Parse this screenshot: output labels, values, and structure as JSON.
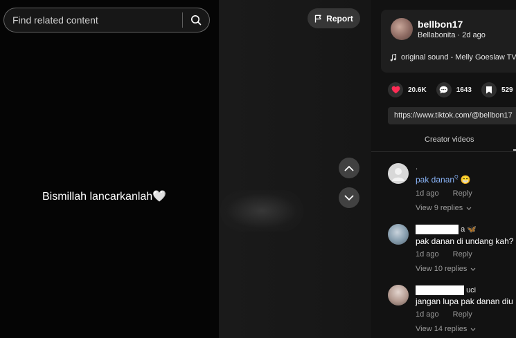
{
  "search": {
    "placeholder": "Find related content"
  },
  "report": {
    "label": "Report"
  },
  "video": {
    "caption": "Bismillah lancarkanlah🤍"
  },
  "author": {
    "username": "bellbon17",
    "nickname_date": "Bellabonita · 2d ago",
    "music": "original sound - Melly Goeslaw TV"
  },
  "stats": {
    "likes": "20.6K",
    "comments": "1643",
    "saves": "529"
  },
  "link": {
    "value": "https://www.tiktok.com/@bellbon17"
  },
  "tabs": {
    "creator_videos": "Creator videos"
  },
  "comments": [
    {
      "name": ".",
      "mention": "pak danan",
      "text_suffix": "😁",
      "date": "1d ago",
      "reply": "Reply",
      "replies": "View 9 replies"
    },
    {
      "name_suffix": "a 🦋",
      "text": "pak danan di undang kah?",
      "date": "1d ago",
      "reply": "Reply",
      "replies": "View 10 replies"
    },
    {
      "name_suffix": "uci",
      "text": "jangan lupa pak danan diu",
      "date": "1d ago",
      "reply": "Reply",
      "replies": "View 14 replies"
    }
  ],
  "colors": {
    "heart": "#fe2c55",
    "panel_bg": "#121212",
    "mention": "#8ab4f8"
  }
}
